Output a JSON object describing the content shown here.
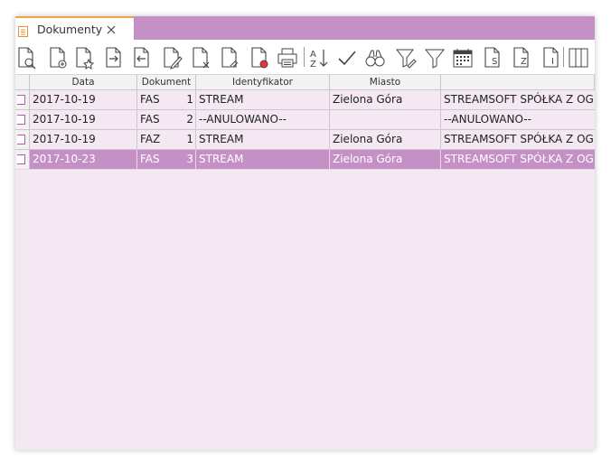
{
  "tab": {
    "label": "Dokumenty",
    "icon": "document-list-icon",
    "close_icon": "close-icon"
  },
  "toolbar": {
    "buttons": [
      {
        "name": "preview-document-icon"
      },
      {
        "name": "add-document-icon"
      },
      {
        "name": "favorite-document-icon"
      },
      {
        "name": "export-document-icon"
      },
      {
        "name": "import-document-icon"
      },
      {
        "name": "edit-document-icon"
      },
      {
        "name": "delete-document-icon"
      },
      {
        "name": "attach-document-icon"
      },
      {
        "name": "new-document-icon"
      },
      {
        "name": "print-icon"
      },
      {
        "name": "sort-az-icon"
      },
      {
        "name": "check-icon"
      },
      {
        "name": "binoculars-icon"
      },
      {
        "name": "filter-edit-icon"
      },
      {
        "name": "filter-icon"
      },
      {
        "name": "calendar-icon"
      },
      {
        "name": "document-s-icon"
      },
      {
        "name": "document-z-icon"
      },
      {
        "name": "document-info-icon"
      },
      {
        "name": "columns-icon"
      }
    ]
  },
  "grid": {
    "columns": [
      "Data",
      "Dokument",
      "Identyfikator",
      "Miasto",
      ""
    ],
    "rows": [
      {
        "date": "2017-10-19",
        "type": "FAS",
        "num": "1",
        "ident": "STREAM",
        "city": "Zielona Góra",
        "name": "STREAMSOFT SPÓŁKA Z OGR",
        "selected": false
      },
      {
        "date": "2017-10-19",
        "type": "FAS",
        "num": "2",
        "ident": "--ANULOWANO--",
        "city": "",
        "name": "--ANULOWANO--",
        "selected": false
      },
      {
        "date": "2017-10-19",
        "type": "FAZ",
        "num": "1",
        "ident": "STREAM",
        "city": "Zielona Góra",
        "name": "STREAMSOFT SPÓŁKA Z OGR",
        "selected": false
      },
      {
        "date": "2017-10-23",
        "type": "FAS",
        "num": "3",
        "ident": "STREAM",
        "city": "Zielona Góra",
        "name": "STREAMSOFT SPÓŁKA Z OGR",
        "selected": true
      }
    ]
  },
  "colors": {
    "accent": "#c590c6",
    "tab_border": "#f0a34a",
    "background": "#f4e9f3"
  }
}
